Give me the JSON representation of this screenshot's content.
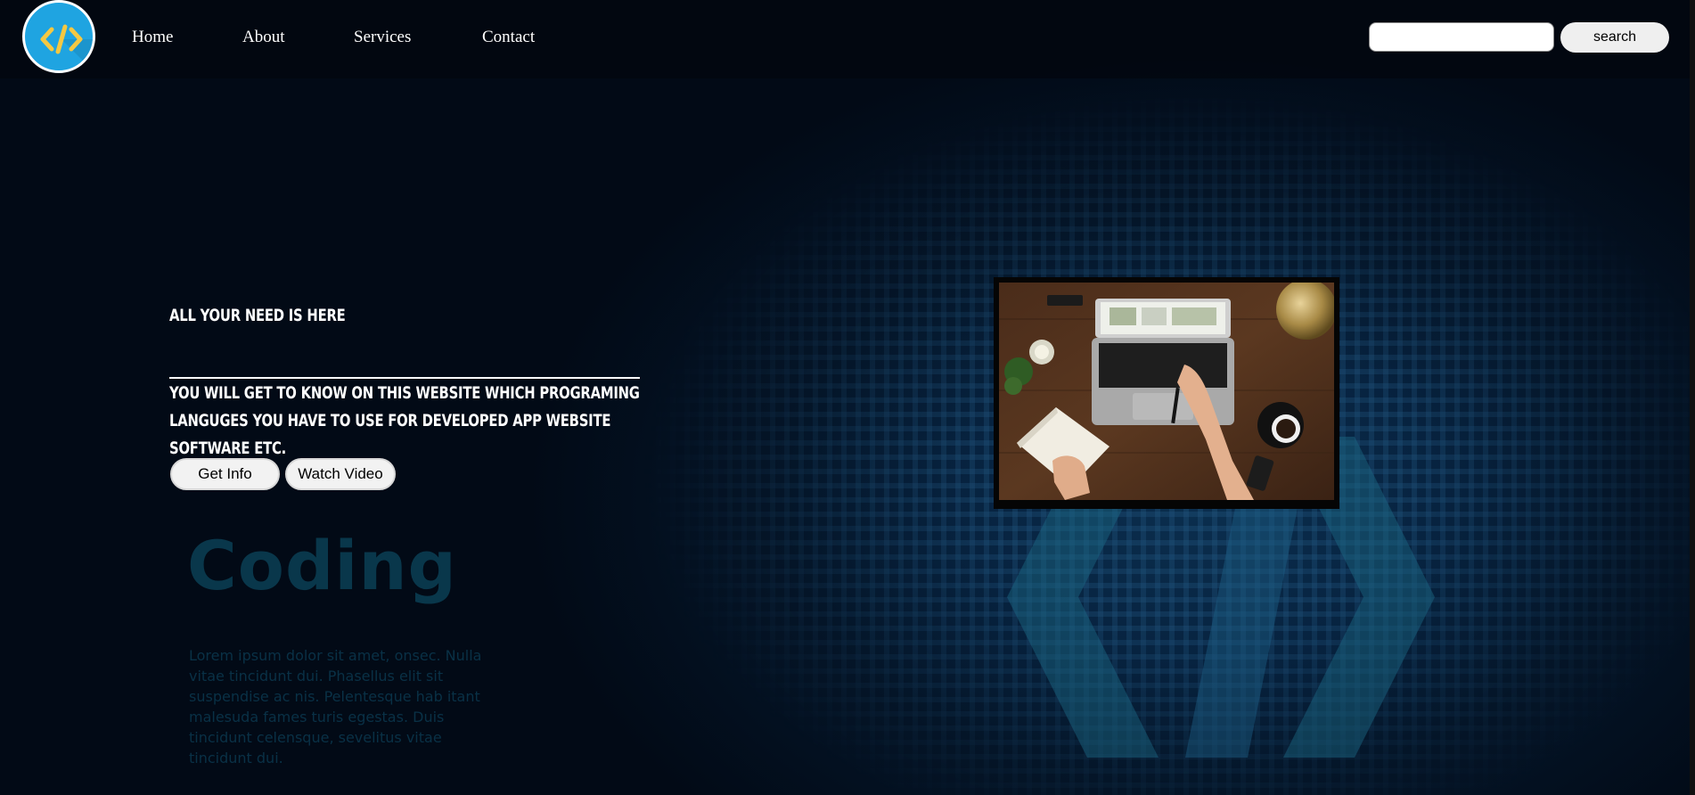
{
  "logo": {
    "glyph": "</>"
  },
  "nav": {
    "items": [
      {
        "label": "Home"
      },
      {
        "label": "About"
      },
      {
        "label": "Services"
      },
      {
        "label": "Contact"
      }
    ]
  },
  "search": {
    "placeholder": "",
    "value": "",
    "button_label": "search"
  },
  "hero": {
    "tagline": "ALL YOUR NEED IS HERE",
    "description": "YOU WILL GET TO KNOW ON THIS WEBSITE WHICH PROGRAMING LANGUGES YOU HAVE TO USE FOR DEVELOPED APP WEBSITE SOFTWARE ETC.",
    "buttons": {
      "get_info": "Get Info",
      "watch_video": "Watch Video"
    }
  },
  "background_art": {
    "heading": "Coding",
    "body": "Lorem ipsum dolor sit amet, onsec. Nulla vitae tincidunt dui. Phasellus elit sit suspendise ac nis. Pelentesque hab itant malesuda fames turis egestas. Duis tincidunt celensque, sevelitus vitae tincidunt dui."
  },
  "colors": {
    "logo_bg": "#1fa4e1",
    "logo_glyph": "#f5c842",
    "background": "#041528",
    "text": "#ffffff"
  },
  "icons": {
    "logo": "code-brackets-icon"
  }
}
